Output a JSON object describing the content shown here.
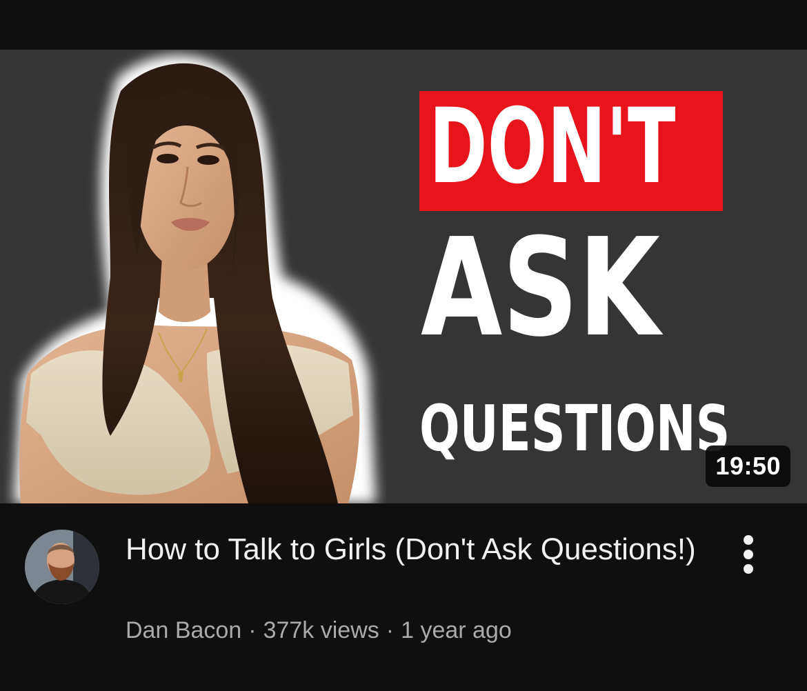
{
  "thumbnail": {
    "headline": [
      "DON'T",
      "ASK",
      "QUESTIONS"
    ],
    "duration": "19:50",
    "colors": {
      "background": "#353535",
      "accent_box": "#e8141b",
      "text": "#ffffff"
    }
  },
  "video": {
    "title": "How to Talk to Girls (Don't Ask Questions!)",
    "channel": "Dan Bacon",
    "views": "377k views",
    "age": "1 year ago",
    "separator": "·"
  },
  "icons": {
    "more": "more-vert-icon",
    "avatar": "channel-avatar"
  }
}
